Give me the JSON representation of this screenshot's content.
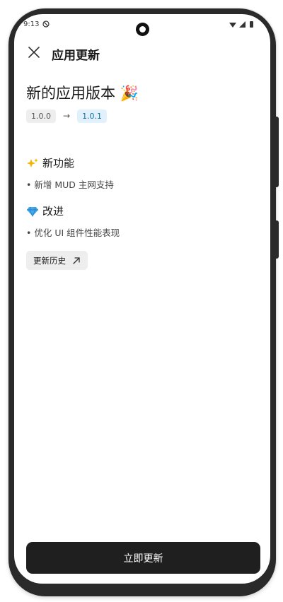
{
  "status_bar": {
    "time": "9:13",
    "icons": [
      "dnd-icon",
      "wifi-icon",
      "signal-icon",
      "battery-icon"
    ]
  },
  "app_bar": {
    "close_icon": "close-icon",
    "title": "应用更新"
  },
  "update": {
    "headline": "新的应用版本 🎉",
    "current_version": "1.0.0",
    "arrow": "→",
    "new_version": "1.0.1"
  },
  "sections": {
    "features": {
      "emoji": "sparkles-icon",
      "title": "新功能",
      "items": [
        "• 新增 MUD 主网支持"
      ]
    },
    "improvements": {
      "emoji": "gem-icon",
      "title": "改进",
      "items": [
        "• 优化 UI 组件性能表现"
      ]
    }
  },
  "history_button": {
    "label": "更新历史",
    "icon": "external-link-icon"
  },
  "primary_button": {
    "label": "立即更新"
  },
  "colors": {
    "primary_button_bg": "#1f1f1f",
    "new_version_bg": "#e1f1fb",
    "new_version_text": "#1a6ea0",
    "chip_bg": "#eeeeee"
  }
}
